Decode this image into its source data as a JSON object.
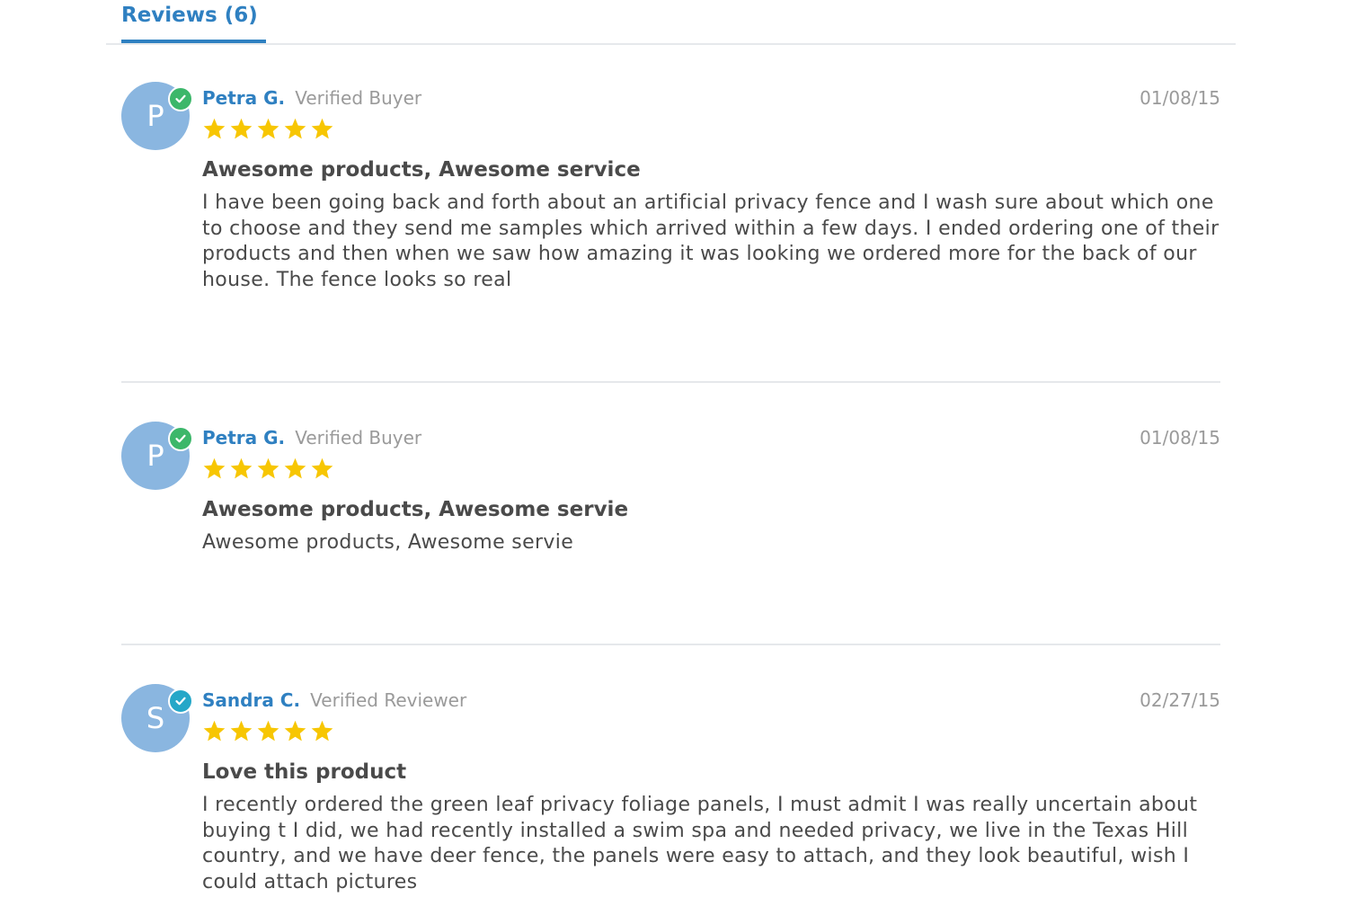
{
  "tabs": {
    "reviews_label": "Reviews (6)"
  },
  "colors": {
    "accent": "#2f80c1",
    "avatar_bg": "#8ab6e0",
    "verified_buyer_badge": "#3cb76a",
    "verified_reviewer_badge": "#25a7c8",
    "star": "#f7c602"
  },
  "reviews": [
    {
      "avatar_letter": "P",
      "badge_icon": "check-circle-icon",
      "name": "Petra G.",
      "role": "Verified Buyer",
      "date": "01/08/15",
      "rating": 5,
      "title": "Awesome products, Awesome service",
      "body": "I have been going back and forth about an artificial privacy fence and I wash sure about which one to choose and they send me samples which arrived within a few days. I ended ordering one of their products and then when we saw how amazing it was looking we ordered more for the back of our house. The fence looks so real"
    },
    {
      "avatar_letter": "P",
      "badge_icon": "check-circle-icon",
      "name": "Petra G.",
      "role": "Verified Buyer",
      "date": "01/08/15",
      "rating": 5,
      "title": "Awesome products, Awesome servie",
      "body": "Awesome products, Awesome servie"
    },
    {
      "avatar_letter": "S",
      "badge_icon": "check-circle-icon",
      "name": "Sandra C.",
      "role": "Verified Reviewer",
      "date": "02/27/15",
      "rating": 5,
      "title": "Love this product",
      "body": "I recently ordered the green leaf privacy foliage panels, I must admit I was really uncertain about buying t I did, we had recently installed a swim spa and needed privacy, we live in the Texas Hill country, and we have deer fence, the panels were easy to attach, and they look beautiful, wish I could attach pictures"
    }
  ]
}
